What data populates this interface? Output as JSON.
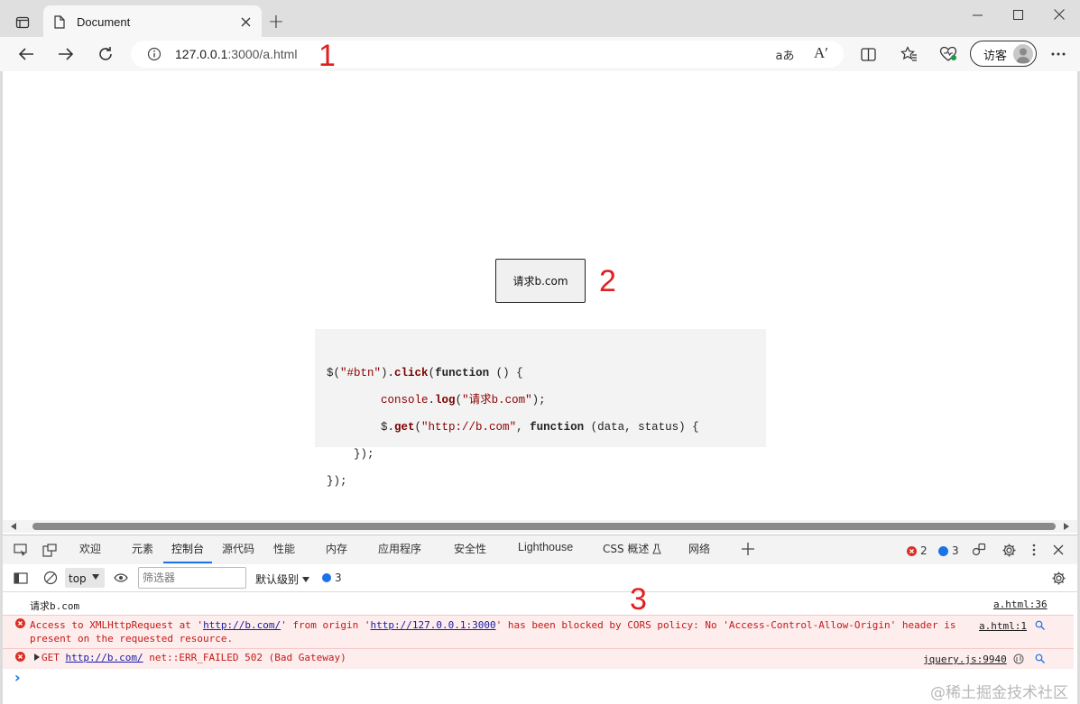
{
  "browser": {
    "tab_title": "Document",
    "new_tab_symbol": "+",
    "url_host": "127.0.0.1",
    "url_path": ":3000/a.html",
    "read_aloud": "Aʹ",
    "translate": "aあ",
    "profile_label": "访客"
  },
  "annotations": {
    "one": "1",
    "two": "2",
    "three": "3"
  },
  "page": {
    "button_label": "请求b.com",
    "code_lines": [
      "$(\"#btn\").click(function () {",
      "        console.log(\"请求b.com\");",
      "        $.get(\"http://b.com\", function (data, status) {",
      "    });",
      "});"
    ]
  },
  "devtools": {
    "tabs": [
      "欢迎",
      "元素",
      "控制台",
      "源代码",
      "性能",
      "内存",
      "应用程序",
      "安全性",
      "Lighthouse",
      "CSS 概述",
      "网络"
    ],
    "active_tab": "控制台",
    "error_count": "2",
    "info_count": "3",
    "context": "top",
    "filter_placeholder": "筛选器",
    "levels": "默认级别",
    "levels_count": "3"
  },
  "console": {
    "log_text": "请求b.com",
    "log_source": "a.html:36",
    "err1_pre": "Access to XMLHttpRequest at '",
    "err1_url1": "http://b.com/",
    "err1_mid": "' from origin '",
    "err1_url2": "http://127.0.0.1:3000",
    "err1_post": "' has been blocked by CORS policy: No 'Access-Control-Allow-Origin' header is",
    "err1_line2": "present on the requested resource.",
    "err1_source": "a.html:1",
    "err2_method": "GET",
    "err2_url": "http://b.com/",
    "err2_rest": " net::ERR_FAILED 502 (Bad Gateway)",
    "err2_source": "jquery.js:9940",
    "prompt": "›"
  },
  "watermark": "@稀土掘金技术社区",
  "colors": {
    "annotation_red": "#e02020",
    "error_text": "#c41a16",
    "error_bg": "#fdeded",
    "link_blue": "#1a1aa6",
    "code_keyword": "#7a0000",
    "code_string": "#8b0000",
    "code_bg": "#f3f3f3"
  }
}
